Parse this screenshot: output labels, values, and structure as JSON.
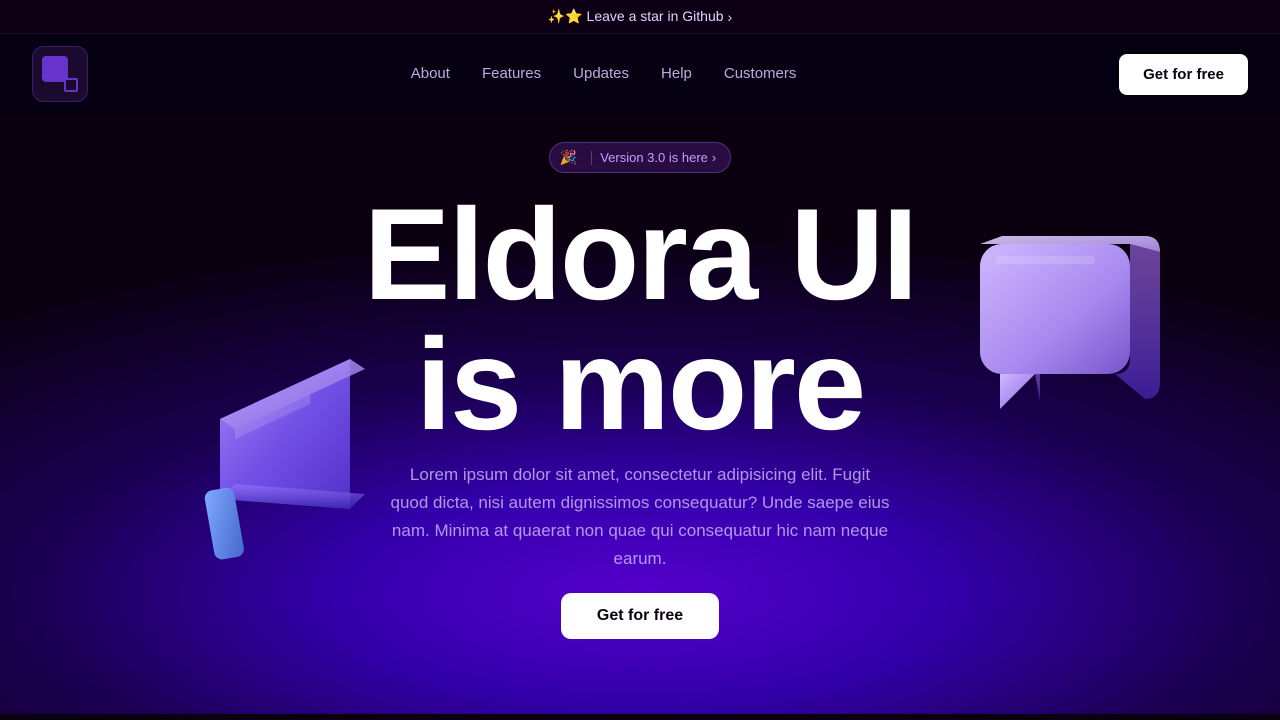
{
  "announcement": {
    "text": "✨⭐ Leave a star in Github",
    "chevron": "›"
  },
  "navbar": {
    "logo_alt": "Eldora UI Logo",
    "links": [
      {
        "label": "About",
        "href": "#"
      },
      {
        "label": "Features",
        "href": "#"
      },
      {
        "label": "Updates",
        "href": "#"
      },
      {
        "label": "Help",
        "href": "#"
      },
      {
        "label": "Customers",
        "href": "#"
      }
    ],
    "cta_label": "Get for free"
  },
  "hero": {
    "version_badge": {
      "icon": "🎉",
      "divider": "|",
      "link_text": "Version 3.0 is here",
      "chevron": "›"
    },
    "title_line1": "Eldora UI",
    "title_line2": "is more",
    "description": "Lorem ipsum dolor sit amet, consectetur adipisicing elit. Fugit quod dicta, nisi autem dignissimos consequatur? Unde saepe eius nam. Minima at quaerat non quae qui consequatur hic nam neque earum.",
    "cta_label": "Get for free"
  }
}
